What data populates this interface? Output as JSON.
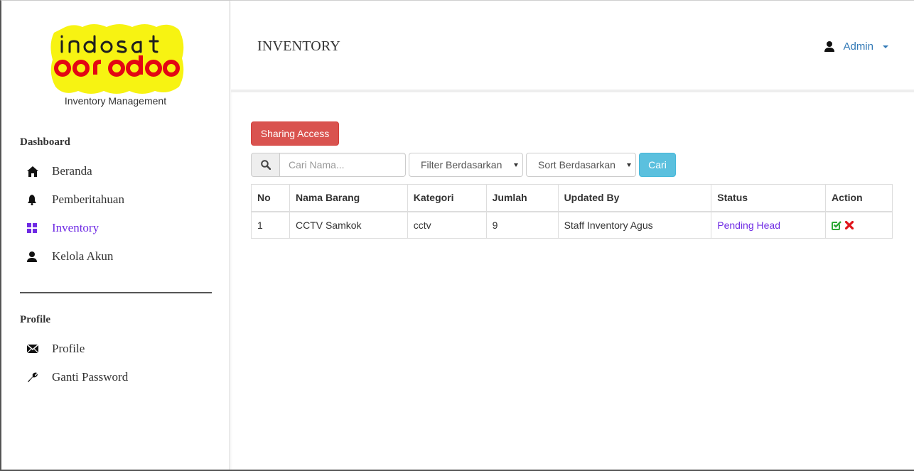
{
  "brand": {
    "logo_line1": "indosat",
    "logo_line2": "ooredoo",
    "subtitle": "Inventory Management",
    "logo_yellow": "#f7f312",
    "logo_red": "#e30613"
  },
  "sidebar": {
    "sections": [
      {
        "heading": "Dashboard",
        "items": [
          {
            "label": "Beranda",
            "icon": "home-icon"
          },
          {
            "label": "Pemberitahuan",
            "icon": "bell-icon"
          },
          {
            "label": "Inventory",
            "icon": "th-large-icon",
            "active": true
          },
          {
            "label": "Kelola Akun",
            "icon": "user-icon"
          }
        ]
      },
      {
        "heading": "Profile",
        "items": [
          {
            "label": "Profile",
            "icon": "envelope-icon"
          },
          {
            "label": "Ganti Password",
            "icon": "wrench-icon"
          }
        ]
      }
    ]
  },
  "header": {
    "title": "INVENTORY",
    "user_label": "Admin"
  },
  "toolbar": {
    "sharing_label": "Sharing Access",
    "search_placeholder": "Cari Nama...",
    "filter_value": "Filter Berdasarkan",
    "sort_value": "Sort Berdasarkan",
    "cari_label": "Cari"
  },
  "table": {
    "columns": [
      "No",
      "Nama Barang",
      "Kategori",
      "Jumlah",
      "Updated By",
      "Status",
      "Action"
    ],
    "rows": [
      {
        "no": "1",
        "nama": "CCTV Samkok",
        "kategori": "cctv",
        "jumlah": "9",
        "updated_by": "Staff Inventory Agus",
        "status": "Pending Head",
        "actions": [
          "approve-icon",
          "reject-icon"
        ]
      }
    ]
  },
  "colors": {
    "accent": "#6f2be4",
    "danger": "#d9534f",
    "info": "#5bc0de",
    "link": "#337ab7",
    "approve": "#2ea836",
    "reject": "#e0151b"
  }
}
